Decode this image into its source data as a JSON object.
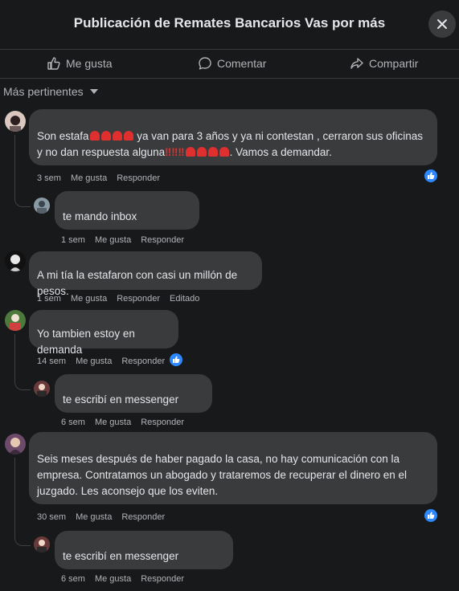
{
  "header": {
    "title": "Publicación de Remates Bancarios Vas por más"
  },
  "actions": {
    "like": "Me gusta",
    "comment": "Comentar",
    "share": "Compartir"
  },
  "filter": {
    "label": "Más pertinentes"
  },
  "comments": [
    {
      "text_a": "Son estafa",
      "text_b": " ya van para 3 años y ya ni contestan , cerraron sus oficinas y no dan respuesta alguna",
      "text_c": ". Vamos a demandar.",
      "time": "3 sem",
      "like": "Me gusta",
      "reply": "Responder",
      "reply_item": {
        "text": "te mando inbox",
        "time": "1 sem",
        "like": "Me gusta",
        "reply": "Responder"
      }
    },
    {
      "text": "A mi tía la estafaron con casi un millón de pesos.",
      "time": "1 sem",
      "like": "Me gusta",
      "reply": "Responder",
      "edited": "Editado"
    },
    {
      "text": "Yo tambien estoy en demanda",
      "time": "14 sem",
      "like": "Me gusta",
      "reply": "Responder",
      "reply_item": {
        "text": "te escribí en messenger",
        "time": "6 sem",
        "like": "Me gusta",
        "reply": "Responder"
      }
    },
    {
      "text": "Seis meses después de haber pagado la casa, no hay comunicación con la empresa. Contratamos un abogado y trataremos de recuperar el dinero en el juzgado. Les aconsejo que los eviten.",
      "time": "30 sem",
      "like": "Me gusta",
      "reply": "Responder",
      "reply_item": {
        "text": "te escribí en messenger",
        "time": "6 sem",
        "like": "Me gusta",
        "reply": "Responder"
      }
    }
  ],
  "colors": {
    "background": "#18191a",
    "bubble": "#3a3b3c",
    "like_badge": "#2d88ff",
    "emoji_red": "#e02f2f"
  }
}
